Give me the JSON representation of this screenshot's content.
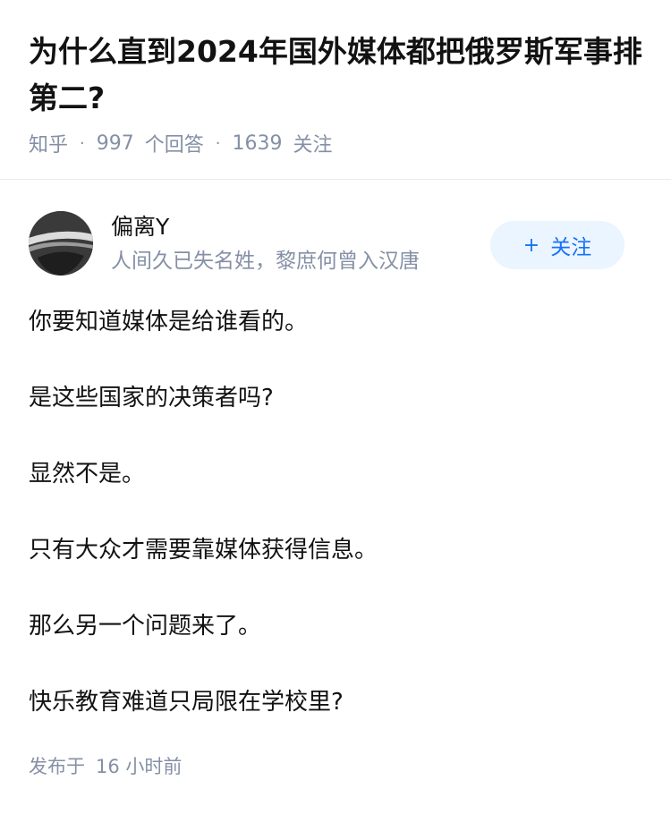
{
  "question": {
    "title": "为什么直到2024年国外媒体都把俄罗斯军事排第二?",
    "source": "知乎",
    "answer_count": "997",
    "answer_label": "个回答",
    "follower_count": "1639",
    "follower_label": "关注"
  },
  "author": {
    "name": "偏离Y",
    "bio": "人间久已失名姓，黎庶何曾入汉唐",
    "follow_label": "关注"
  },
  "answer": {
    "paragraphs": [
      "你要知道媒体是给谁看的。",
      "是这些国家的决策者吗?",
      "显然不是。",
      "只有大众才需要靠媒体获得信息。",
      "那么另一个问题来了。",
      "快乐教育难道只局限在学校里?"
    ],
    "published_prefix": "发布于",
    "published_num": "16",
    "published_suffix": "小时前"
  },
  "colors": {
    "accent": "#1772f6",
    "follow_bg": "#ebf5ff",
    "meta_gray": "#8590a6"
  },
  "icons": {
    "follow": "plus-icon",
    "meta_separator": "dot"
  }
}
